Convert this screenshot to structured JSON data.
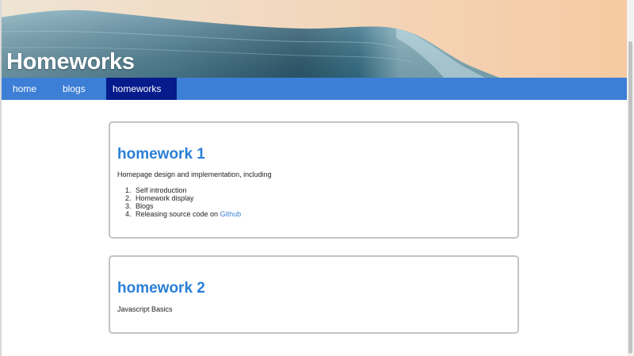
{
  "header": {
    "title": "Homeworks"
  },
  "nav": {
    "items": [
      {
        "label": "home"
      },
      {
        "label": "blogs"
      },
      {
        "label": "homeworks",
        "active": true
      }
    ]
  },
  "homeworks": [
    {
      "title": "homework 1",
      "description": "Homepage design and implementation, including",
      "items": [
        {
          "number": "1.",
          "text": "Self introduction"
        },
        {
          "number": "2.",
          "text": "Homework display"
        },
        {
          "number": "3.",
          "text": "Blogs"
        },
        {
          "number": "4.",
          "text": "Releasing source code on ",
          "link": "Github"
        }
      ]
    },
    {
      "title": "homework 2",
      "description": "Javascript Basics"
    }
  ],
  "colors": {
    "nav_background": "#3d7fd6",
    "nav_active": "#061b8c",
    "card_title": "#2a7fd5",
    "link": "#3d7fd6"
  },
  "icons": {
    "banner_image": "ocean-wave-image"
  }
}
